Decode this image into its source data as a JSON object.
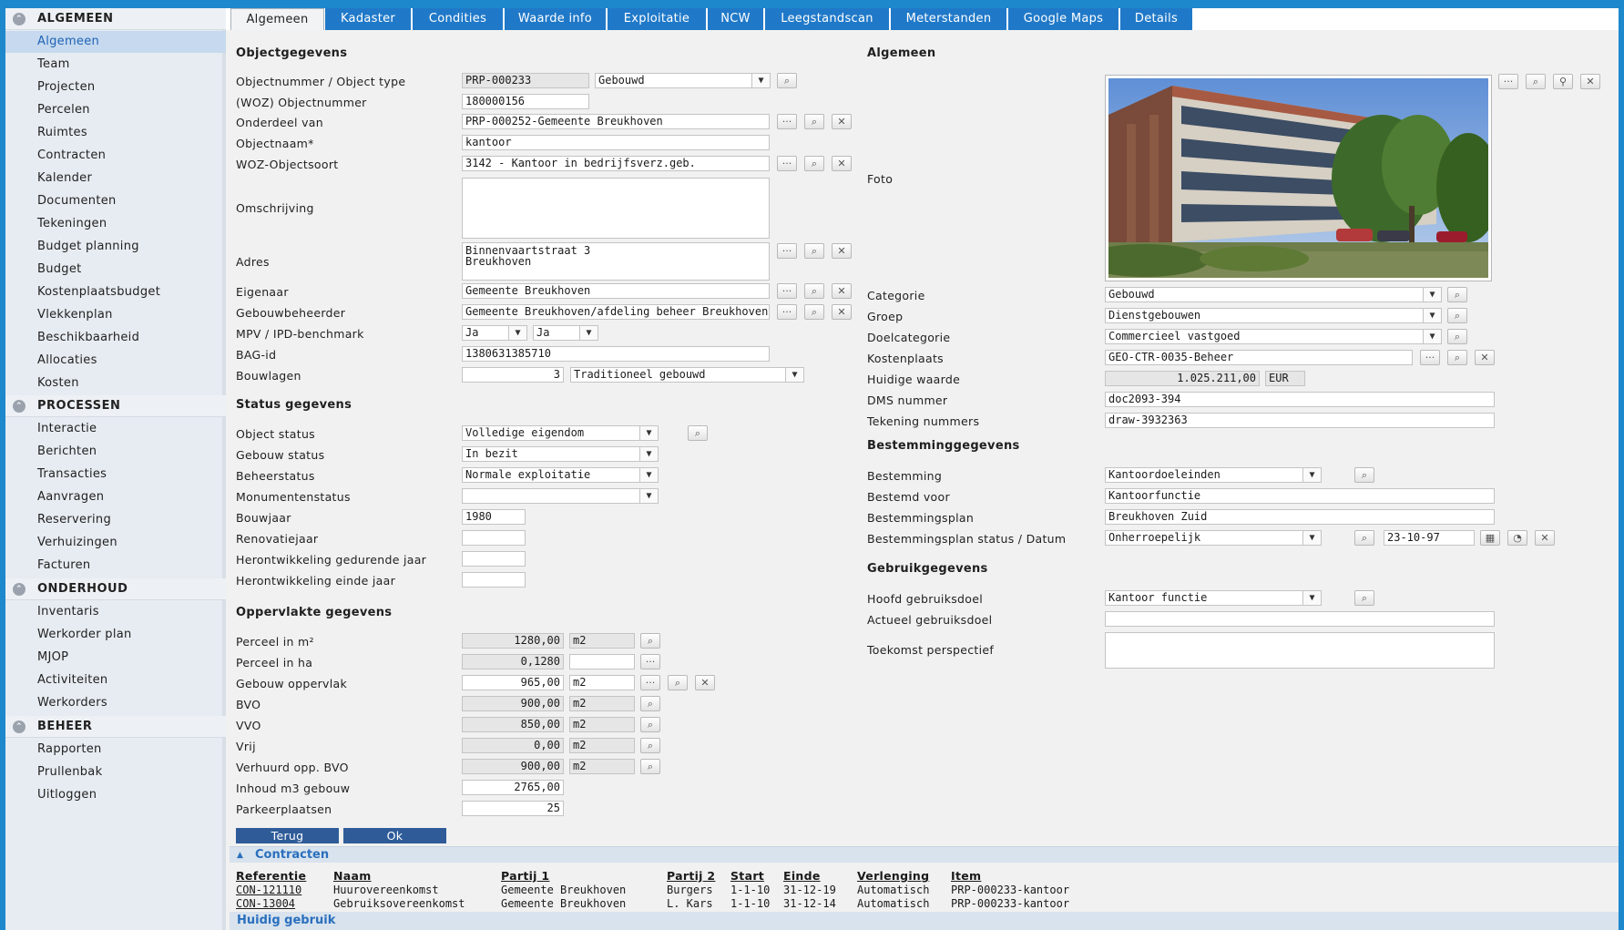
{
  "sidebar": {
    "sections": [
      {
        "title": "ALGEMEEN",
        "items": [
          "Algemeen",
          "Team",
          "Projecten",
          "Percelen",
          "Ruimtes",
          "Contracten",
          "Kalender",
          "Documenten",
          "Tekeningen",
          "Budget planning",
          "Budget",
          "Kostenplaatsbudget",
          "Vlekkenplan",
          "Beschikbaarheid",
          "Allocaties",
          "Kosten"
        ]
      },
      {
        "title": "PROCESSEN",
        "items": [
          "Interactie",
          "Berichten",
          "Transacties",
          "Aanvragen",
          "Reservering",
          "Verhuizingen",
          "Facturen"
        ]
      },
      {
        "title": "ONDERHOUD",
        "items": [
          "Inventaris",
          "Werkorder plan",
          "MJOP",
          "Activiteiten",
          "Werkorders"
        ]
      },
      {
        "title": "BEHEER",
        "items": [
          "Rapporten",
          "Prullenbak",
          "Uitloggen"
        ]
      }
    ],
    "active_item": "Algemeen"
  },
  "tabs": [
    "Algemeen",
    "Kadaster",
    "Condities",
    "Waarde info",
    "Exploitatie",
    "NCW",
    "Leegstandscan",
    "Meterstanden",
    "Google Maps",
    "Details"
  ],
  "objectgegevens": {
    "title": "Objectgegevens",
    "labels": {
      "objectnummer": "Objectnummer / Object type",
      "woz_objectnummer": "(WOZ) Objectnummer",
      "onderdeel_van": "Onderdeel van",
      "objectnaam": "Objectnaam*",
      "woz_objectsoort": "WOZ-Objectsoort",
      "omschrijving": "Omschrijving",
      "adres": "Adres",
      "eigenaar": "Eigenaar",
      "gebouwbeheerder": "Gebouwbeheerder",
      "mpv": "MPV / IPD-benchmark",
      "bag_id": "BAG-id",
      "bouwlagen": "Bouwlagen"
    },
    "values": {
      "objectnummer": "PRP-000233",
      "object_type": "Gebouwd",
      "woz_objectnummer": "180000156",
      "onderdeel_van": "PRP-000252-Gemeente Breukhoven",
      "objectnaam": "kantoor",
      "woz_objectsoort": "3142 - Kantoor in bedrijfsverz.geb.",
      "omschrijving": "",
      "adres": "Binnenvaartstraat 3\nBreukhoven",
      "eigenaar": "Gemeente Breukhoven",
      "gebouwbeheerder": "Gemeente Breukhoven/afdeling beheer Breukhoven",
      "mpv": "Ja",
      "ipd": "Ja",
      "bag_id": "1380631385710",
      "bouwlagen": "3",
      "bouwlagen_type": "Traditioneel gebouwd"
    }
  },
  "status": {
    "title": "Status gegevens",
    "labels": {
      "object_status": "Object status",
      "gebouw_status": "Gebouw status",
      "beheerstatus": "Beheerstatus",
      "monumentenstatus": "Monumentenstatus",
      "bouwjaar": "Bouwjaar",
      "renovatiejaar": "Renovatiejaar",
      "herontw_gedurende": "Herontwikkeling gedurende jaar",
      "herontw_einde": "Herontwikkeling einde jaar"
    },
    "values": {
      "object_status": "Volledige eigendom",
      "gebouw_status": "In bezit",
      "beheerstatus": "Normale exploitatie",
      "monumentenstatus": "",
      "bouwjaar": "1980",
      "renovatiejaar": "",
      "herontw_gedurende": "",
      "herontw_einde": ""
    }
  },
  "oppervlakte": {
    "title": "Oppervlakte gegevens",
    "rows": [
      {
        "label": "Perceel in m²",
        "value": "1280,00",
        "unit": "m2"
      },
      {
        "label": "Perceel in ha",
        "value": "0,1280",
        "unit": ""
      },
      {
        "label": "Gebouw oppervlak",
        "value": "965,00",
        "unit": "m2"
      },
      {
        "label": "BVO",
        "value": "900,00",
        "unit": "m2"
      },
      {
        "label": "VVO",
        "value": "850,00",
        "unit": "m2"
      },
      {
        "label": "Vrij",
        "value": "0,00",
        "unit": "m2"
      },
      {
        "label": "Verhuurd opp. BVO",
        "value": "900,00",
        "unit": "m2"
      },
      {
        "label": "Inhoud m3 gebouw",
        "value": "2765,00",
        "unit": ""
      },
      {
        "label": "Parkeerplaatsen",
        "value": "25",
        "unit": ""
      }
    ]
  },
  "buttons": {
    "terug": "Terug",
    "ok": "Ok"
  },
  "algemeen": {
    "title": "Algemeen",
    "labels": {
      "foto": "Foto",
      "categorie": "Categorie",
      "groep": "Groep",
      "doelcategorie": "Doelcategorie",
      "kostenplaats": "Kostenplaats",
      "huidige_waarde": "Huidige waarde",
      "dms": "DMS nummer",
      "tekening": "Tekening nummers"
    },
    "values": {
      "categorie": "Gebouwd",
      "groep": "Dienstgebouwen",
      "doelcategorie": "Commercieel vastgoed",
      "kostenplaats": "GEO-CTR-0035-Beheer",
      "huidige_waarde": "1.025.211,00",
      "valuta": "EUR",
      "dms": "doc2093-394",
      "tekening": "draw-3932363"
    }
  },
  "bestemming": {
    "title": "Bestemminggegevens",
    "labels": {
      "bestemming": "Bestemming",
      "bestemd_voor": "Bestemd voor",
      "bestemmingsplan": "Bestemmingsplan",
      "plan_status": "Bestemmingsplan status / Datum"
    },
    "values": {
      "bestemming": "Kantoordoeleinden",
      "bestemd_voor": "Kantoorfunctie",
      "bestemmingsplan": "Breukhoven Zuid",
      "plan_status": "Onherroepelijk",
      "datum": "23-10-97"
    }
  },
  "gebruik": {
    "title": "Gebruikgegevens",
    "labels": {
      "hoofd": "Hoofd gebruiksdoel",
      "actueel": "Actueel gebruiksdoel",
      "toekomst": "Toekomst perspectief"
    },
    "values": {
      "hoofd": "Kantoor functie",
      "actueel": "",
      "toekomst": ""
    }
  },
  "contracten": {
    "title": "Contracten",
    "headers": [
      "Referentie",
      "Naam",
      "Partij 1",
      "Partij 2",
      "Start",
      "Einde",
      "Verlenging",
      "Item"
    ],
    "rows": [
      [
        "CON-121110",
        "Huurovereenkomst",
        "Gemeente Breukhoven",
        "Burgers",
        "1-1-10",
        "31-12-19",
        "Automatisch",
        "PRP-000233-kantoor"
      ],
      [
        "CON-13004",
        "Gebruiksovereenkomst",
        "Gemeente Breukhoven",
        "L. Kars",
        "1-1-10",
        "31-12-14",
        "Automatisch",
        "PRP-000233-kantoor"
      ]
    ]
  },
  "huidig_gebruik": {
    "title": "Huidig gebruik"
  },
  "icons": {
    "search": "search-icon",
    "more": "more-icon",
    "clear": "clear-icon",
    "dropdown": "chevron-down-icon",
    "calendar": "calendar-icon",
    "section": "chevron-up-circle-icon"
  }
}
